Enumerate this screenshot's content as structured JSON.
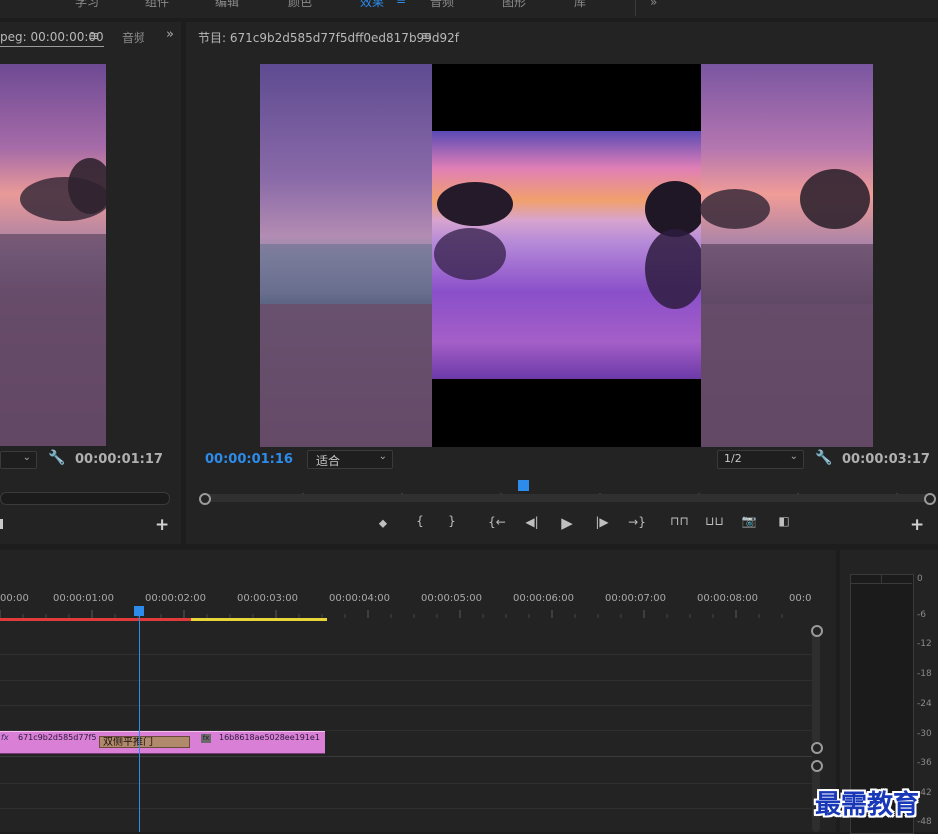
{
  "workspaces": [
    "学习",
    "组件",
    "编辑",
    "颜色",
    "效果",
    "音频",
    "图形",
    "库"
  ],
  "active_workspace": "效果",
  "source_panel": {
    "tab_label": "peg: 00:00:00:00",
    "next_tab_label": "音频",
    "timecode": "00:00:01:17"
  },
  "program_panel": {
    "title": "节目: 671c9b2d585d77f5dff0ed817b99d92f",
    "current_timecode": "00:00:01:16",
    "fit_label": "适合",
    "resolution": "1/2",
    "duration": "00:00:03:17",
    "playhead_fraction": 0.44
  },
  "timeline": {
    "ruler_labels": [
      "00:00",
      "00:00:01:00",
      "00:00:02:00",
      "00:00:03:00",
      "00:00:04:00",
      "00:00:05:00",
      "00:00:06:00",
      "00:00:07:00",
      "00:00:08:00",
      "00:0"
    ],
    "clip1_label": "671c9b2d585d77f5",
    "transition_label": "双侧平推门",
    "clip2_label": "16b8618ae5028ee191e1",
    "fx_label": "fx"
  },
  "meter_labels": [
    "-6",
    "-12",
    "-18",
    "-24",
    "-30",
    "-36",
    "-42",
    "-48"
  ],
  "watermark": "最需教育",
  "colors": {
    "accent": "#2d8ceb",
    "clip": "#d97fd5",
    "transition": "#b08a6a",
    "render_red": "#e03a3a",
    "render_yellow": "#e6d63a"
  }
}
